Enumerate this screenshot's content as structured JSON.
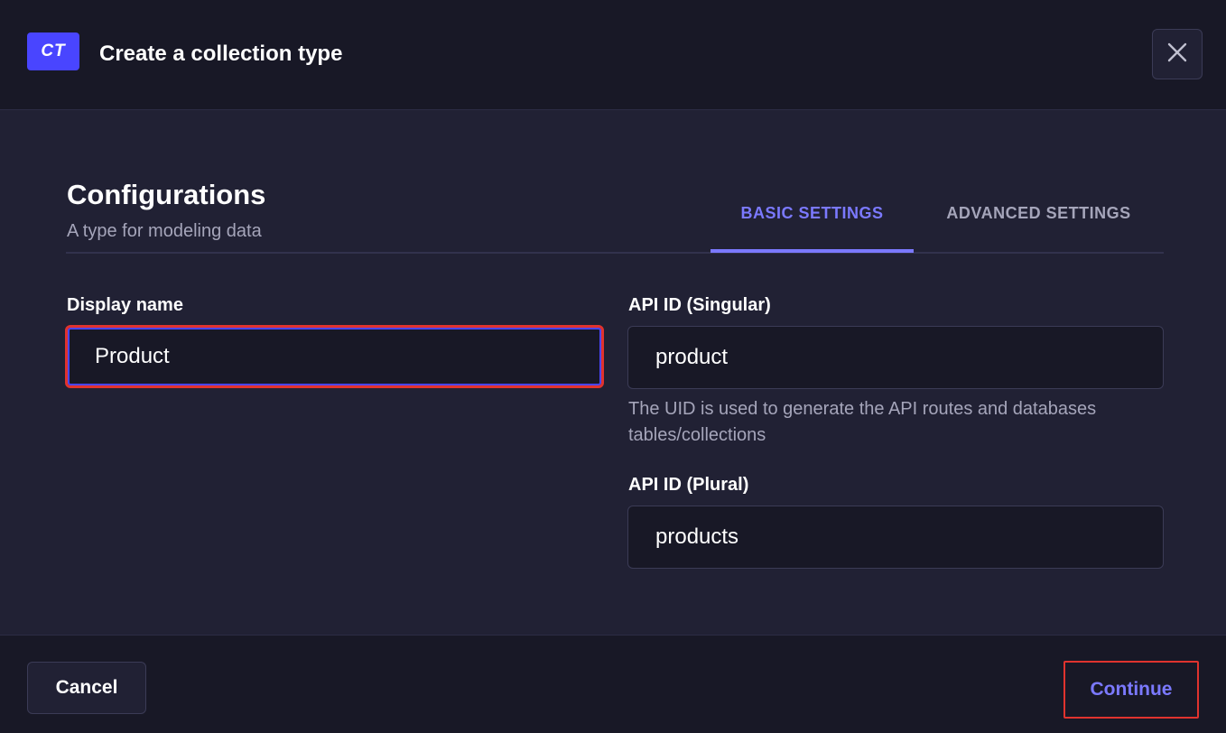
{
  "header": {
    "badge": "CT",
    "title": "Create a collection type",
    "close_icon": "close-icon"
  },
  "config": {
    "title": "Configurations",
    "subtitle": "A type for modeling data"
  },
  "tabs": [
    {
      "label": "BASIC SETTINGS",
      "active": true
    },
    {
      "label": "ADVANCED SETTINGS",
      "active": false
    }
  ],
  "fields": {
    "display_name": {
      "label": "Display name",
      "value": "Product"
    },
    "api_singular": {
      "label": "API ID (Singular)",
      "value": "product",
      "hint": "The UID is used to generate the API routes and databases tables/collections"
    },
    "api_plural": {
      "label": "API ID (Plural)",
      "value": "products"
    }
  },
  "footer": {
    "cancel_label": "Cancel",
    "continue_label": "Continue"
  },
  "colors": {
    "accent": "#4945ff",
    "active_tab": "#7b79ff",
    "background": "#212134",
    "header_background": "#181826",
    "highlight": "#e0332e"
  }
}
